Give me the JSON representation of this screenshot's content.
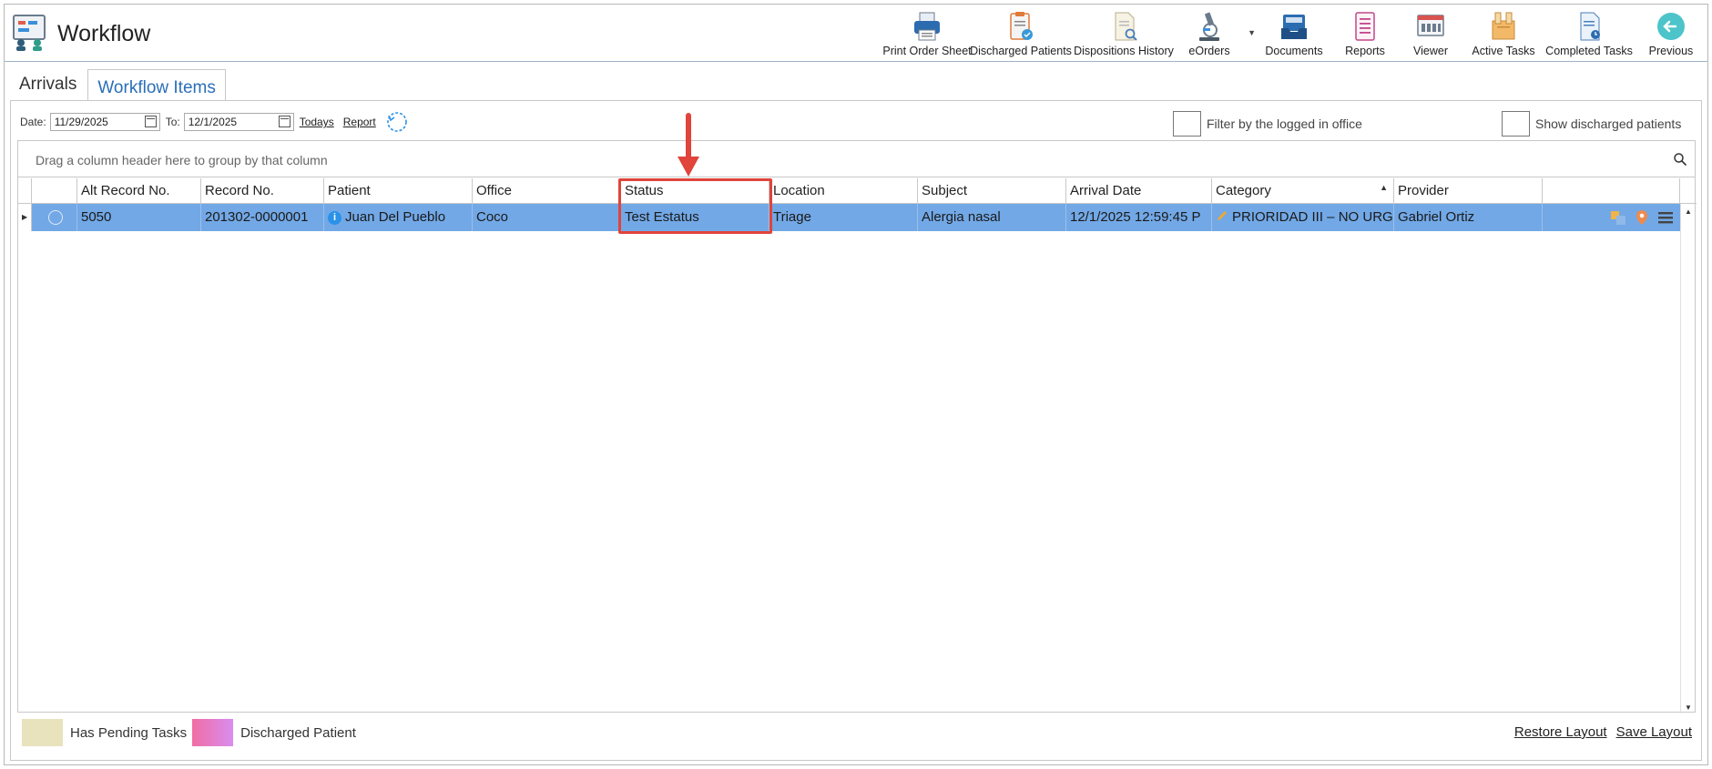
{
  "app": {
    "title": "Workflow"
  },
  "toolbar": {
    "items": [
      {
        "label": "Print Order Sheet",
        "icon": "printer-icon"
      },
      {
        "label": "Discharged Patients",
        "icon": "discharged-clipboard-icon"
      },
      {
        "label": "Dispositions History",
        "icon": "document-search-icon"
      },
      {
        "label": "eOrders",
        "icon": "microscope-icon"
      },
      {
        "label": "Documents",
        "icon": "inbox-tray-icon"
      },
      {
        "label": "Reports",
        "icon": "report-list-icon"
      },
      {
        "label": "Viewer",
        "icon": "viewer-window-icon"
      },
      {
        "label": "Active Tasks",
        "icon": "task-box-icon"
      },
      {
        "label": "Completed Tasks",
        "icon": "completed-document-icon"
      },
      {
        "label": "Previous",
        "icon": "back-arrow-icon"
      }
    ]
  },
  "tabs": {
    "arrivals": "Arrivals",
    "workflow_items": "Workflow Items"
  },
  "filters": {
    "date_label": "Date:",
    "date_from": "11/29/2025",
    "to_label": "To:",
    "date_to": "12/1/2025",
    "todays_link": "Todays",
    "report_link": "Report",
    "filter_office_label": "Filter by the logged in office",
    "show_discharged_label": "Show discharged patients"
  },
  "grid": {
    "group_panel_text": "Drag a column header here to group by that column",
    "columns": [
      "Alt Record No.",
      "Record No.",
      "Patient",
      "Office",
      "Status",
      "Location",
      "Subject",
      "Arrival Date",
      "Category",
      "Provider"
    ],
    "rows": [
      {
        "alt_record_no": "5050",
        "record_no": "201302-0000001",
        "patient": "Juan Del Pueblo",
        "office": "Coco",
        "status": "Test Estatus",
        "location": "Triage",
        "subject": "Alergia nasal",
        "arrival_date": "12/1/2025 12:59:45 P",
        "category": "PRIORIDAD III – NO URG",
        "provider": "Gabriel Ortiz"
      }
    ]
  },
  "legend": {
    "pending": "Has Pending Tasks",
    "discharged": "Discharged Patient",
    "pending_color": "#e8e2bd",
    "discharged_color": "#f06ea3"
  },
  "footer": {
    "restore_layout": "Restore Layout",
    "save_layout": "Save Layout"
  },
  "colors": {
    "selected_row": "#72a8e6",
    "tab_active": "#2a6fb8",
    "annotation": "#e0443a"
  }
}
